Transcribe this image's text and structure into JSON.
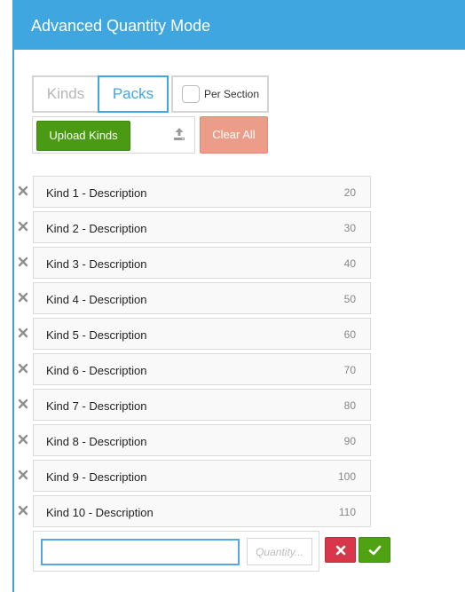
{
  "header": {
    "title": "Advanced Quantity Mode",
    "background": "#3fa6e0"
  },
  "mode_toggle": {
    "kinds_label": "Kinds",
    "packs_label": "Packs",
    "selected": "Packs"
  },
  "per_section": {
    "label": "Per Section",
    "checked": false
  },
  "upload": {
    "button_label": "Upload Kinds",
    "icon": "upload-icon"
  },
  "clear_all": {
    "label": "Clear All"
  },
  "items": [
    {
      "label": "Kind 1 - Description",
      "quantity": "20"
    },
    {
      "label": "Kind 2 - Description",
      "quantity": "30"
    },
    {
      "label": "Kind 3 - Description",
      "quantity": "40"
    },
    {
      "label": "Kind 4 - Description",
      "quantity": "50"
    },
    {
      "label": "Kind 5 - Description",
      "quantity": "60"
    },
    {
      "label": "Kind 6 - Description",
      "quantity": "70"
    },
    {
      "label": "Kind 7 - Description",
      "quantity": "80"
    },
    {
      "label": "Kind 8 - Description",
      "quantity": "90"
    },
    {
      "label": "Kind 9 - Description",
      "quantity": "100"
    },
    {
      "label": "Kind 10 - Description",
      "quantity": "110"
    }
  ],
  "entry": {
    "kind_value": "",
    "quantity_placeholder": "Quantity...",
    "cancel_icon": "close-icon",
    "confirm_icon": "check-icon"
  },
  "colors": {
    "accent": "#3fa6e0",
    "upload_button": "#4a9a13",
    "clear_button": "#ec9d8a",
    "cancel_button": "#d8364a",
    "confirm_button": "#4fa313"
  }
}
